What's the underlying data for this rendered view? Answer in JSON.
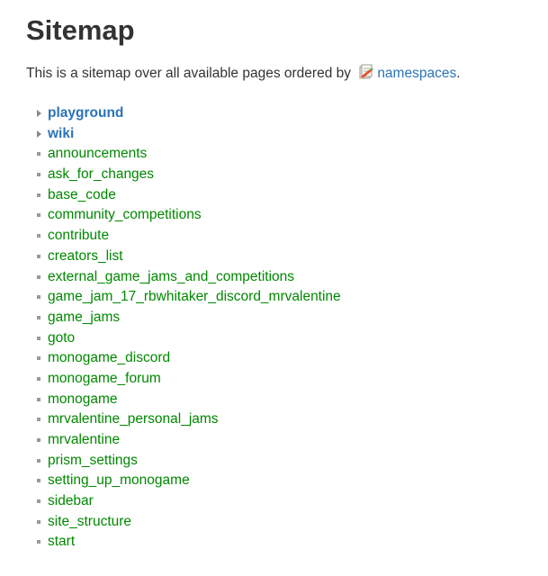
{
  "page": {
    "title": "Sitemap",
    "intro_before": "This is a sitemap over all available pages ordered by",
    "intro_link": "namespaces",
    "intro_after": "."
  },
  "icons": {
    "namespace_icon": "namespace-pages-icon",
    "namespace_marker": "collapsed-arrow-icon",
    "page_marker": "square-bullet-icon"
  },
  "colors": {
    "namespace_link": "#2b73b7",
    "page_link": "#008800",
    "text": "#333333"
  },
  "sitemap": {
    "namespaces": [
      "playground",
      "wiki"
    ],
    "pages": [
      "announcements",
      "ask_for_changes",
      "base_code",
      "community_competitions",
      "contribute",
      "creators_list",
      "external_game_jams_and_competitions",
      "game_jam_17_rbwhitaker_discord_mrvalentine",
      "game_jams",
      "goto",
      "monogame_discord",
      "monogame_forum",
      "monogame",
      "mrvalentine_personal_jams",
      "mrvalentine",
      "prism_settings",
      "setting_up_monogame",
      "sidebar",
      "site_structure",
      "start"
    ]
  }
}
